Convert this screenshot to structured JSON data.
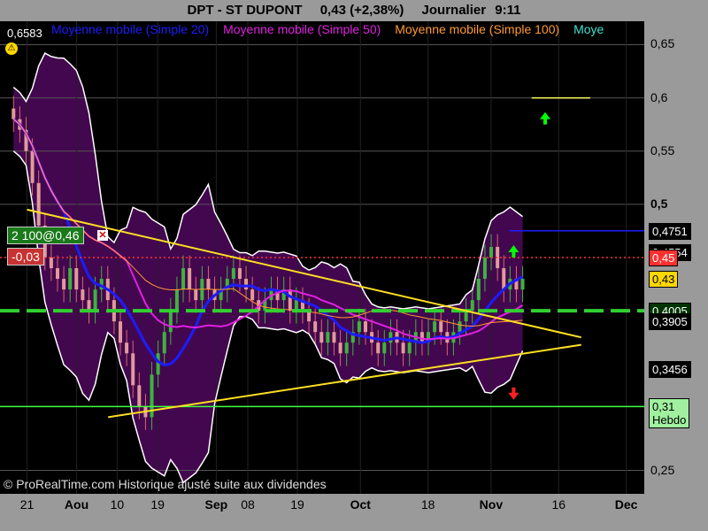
{
  "header": {
    "ticker": "DPT - ST DUPONT",
    "quote": "0,43 (+2,38%)",
    "period": "Journalier",
    "time": "9:11"
  },
  "legend": [
    {
      "label": "Moyenne mobile (Simple 20)",
      "color": "#1c1cff"
    },
    {
      "label": "Moyenne mobile (Simple 50)",
      "color": "#e020e0"
    },
    {
      "label": "Moyenne mobile (Simple 100)",
      "color": "#ff9a30"
    },
    {
      "label": "Moye",
      "color": "#40e0d0"
    }
  ],
  "last_value_label": "0,6583",
  "order_label": "2 100@0,46",
  "pl_label": "-0,03",
  "copyright": "© ProRealTime.com Historique ajusté suite aux dividendes",
  "y_axis_tags": [
    {
      "text": "0,4751",
      "value": 0.4751,
      "bg": "#000000",
      "fg": "#ffffff"
    },
    {
      "text": "0,4554",
      "value": 0.4554,
      "bg": "#000000",
      "fg": "#ffffff"
    },
    {
      "text": "0,45",
      "value": 0.45,
      "bg": "#ff3030",
      "fg": "#ffffff"
    },
    {
      "text": "0,43",
      "value": 0.43,
      "bg": "#ffd700",
      "fg": "#000000"
    },
    {
      "text": "0,4005",
      "value": 0.4005,
      "bg": "#003300",
      "fg": "#ffffff"
    },
    {
      "text": "0,3905",
      "value": 0.3905,
      "bg": "#000000",
      "fg": "#ffffff"
    },
    {
      "text": "0,3456",
      "value": 0.3456,
      "bg": "#000000",
      "fg": "#ffffff"
    },
    {
      "text": "0,31\nHebdo",
      "value": 0.31,
      "bg": "#a0f0a0",
      "fg": "#000000"
    }
  ],
  "chart_data": {
    "type": "candlestick",
    "title": "DPT - ST DUPONT",
    "y_ticks": [
      {
        "label": "0,65",
        "value": 0.65,
        "bold": false
      },
      {
        "label": "0,6",
        "value": 0.6,
        "bold": false
      },
      {
        "label": "0,55",
        "value": 0.55,
        "bold": false
      },
      {
        "label": "0,5",
        "value": 0.5,
        "bold": true
      },
      {
        "label": "0,25",
        "value": 0.25,
        "bold": false
      }
    ],
    "x_ticks": [
      {
        "label": "21",
        "date": "2011-07-21",
        "bold": false
      },
      {
        "label": "Aou",
        "date": "2011-08-01",
        "bold": true
      },
      {
        "label": "10",
        "date": "2011-08-10",
        "bold": false
      },
      {
        "label": "19",
        "date": "2011-08-19",
        "bold": false
      },
      {
        "label": "Sep",
        "date": "2011-09-01",
        "bold": true
      },
      {
        "label": "08",
        "date": "2011-09-08",
        "bold": false
      },
      {
        "label": "19",
        "date": "2011-09-19",
        "bold": false
      },
      {
        "label": "Oct",
        "date": "2011-10-03",
        "bold": true
      },
      {
        "label": "18",
        "date": "2011-10-18",
        "bold": false
      },
      {
        "label": "Nov",
        "date": "2011-11-01",
        "bold": true
      },
      {
        "label": "16",
        "date": "2011-11-16",
        "bold": false
      },
      {
        "label": "Dec",
        "date": "2011-12-01",
        "bold": true
      }
    ],
    "ylim": [
      0.228,
      0.672
    ],
    "xlim": [
      "2011-07-15",
      "2011-12-05"
    ],
    "closes": [
      0.58,
      0.57,
      0.55,
      0.52,
      0.48,
      0.45,
      0.44,
      0.43,
      0.42,
      0.44,
      0.42,
      0.41,
      0.4,
      0.42,
      0.43,
      0.41,
      0.39,
      0.37,
      0.36,
      0.33,
      0.31,
      0.3,
      0.34,
      0.36,
      0.38,
      0.4,
      0.42,
      0.44,
      0.42,
      0.41,
      0.43,
      0.42,
      0.41,
      0.42,
      0.43,
      0.44,
      0.43,
      0.42,
      0.41,
      0.4,
      0.41,
      0.42,
      0.41,
      0.42,
      0.4,
      0.41,
      0.4,
      0.39,
      0.38,
      0.37,
      0.38,
      0.37,
      0.36,
      0.37,
      0.38,
      0.39,
      0.38,
      0.37,
      0.36,
      0.37,
      0.38,
      0.37,
      0.36,
      0.37,
      0.38,
      0.37,
      0.38,
      0.39,
      0.38,
      0.37,
      0.38,
      0.39,
      0.4,
      0.41,
      0.43,
      0.45,
      0.46,
      0.44,
      0.42,
      0.43,
      0.42,
      0.43
    ],
    "horizontal_lines": [
      {
        "value": 0.4751,
        "color": "#1c1cff",
        "style": "solid",
        "from": "2011-11-05"
      },
      {
        "value": 0.45,
        "color": "#ff3030",
        "style": "dotted"
      },
      {
        "value": 0.4,
        "color": "#30d030",
        "style": "dashed"
      },
      {
        "value": 0.31,
        "color": "#40ff40",
        "style": "solid"
      },
      {
        "value": 0.6,
        "color": "#ffff60",
        "style": "solid",
        "from": "2011-11-10",
        "to": "2011-11-23"
      }
    ],
    "trend_lines": [
      {
        "color": "#ffe020",
        "points": [
          [
            "2011-07-21",
            0.495
          ],
          [
            "2011-11-21",
            0.375
          ]
        ]
      },
      {
        "color": "#ffe020",
        "points": [
          [
            "2011-08-08",
            0.3
          ],
          [
            "2011-11-21",
            0.368
          ]
        ]
      }
    ],
    "signals": [
      {
        "type": "up",
        "date": "2011-11-13",
        "value": 0.58,
        "color": "#00ff00"
      },
      {
        "type": "up",
        "date": "2011-11-06",
        "value": 0.455,
        "color": "#00ff00"
      },
      {
        "type": "down",
        "date": "2011-11-06",
        "value": 0.323,
        "color": "#ff2020"
      }
    ]
  }
}
